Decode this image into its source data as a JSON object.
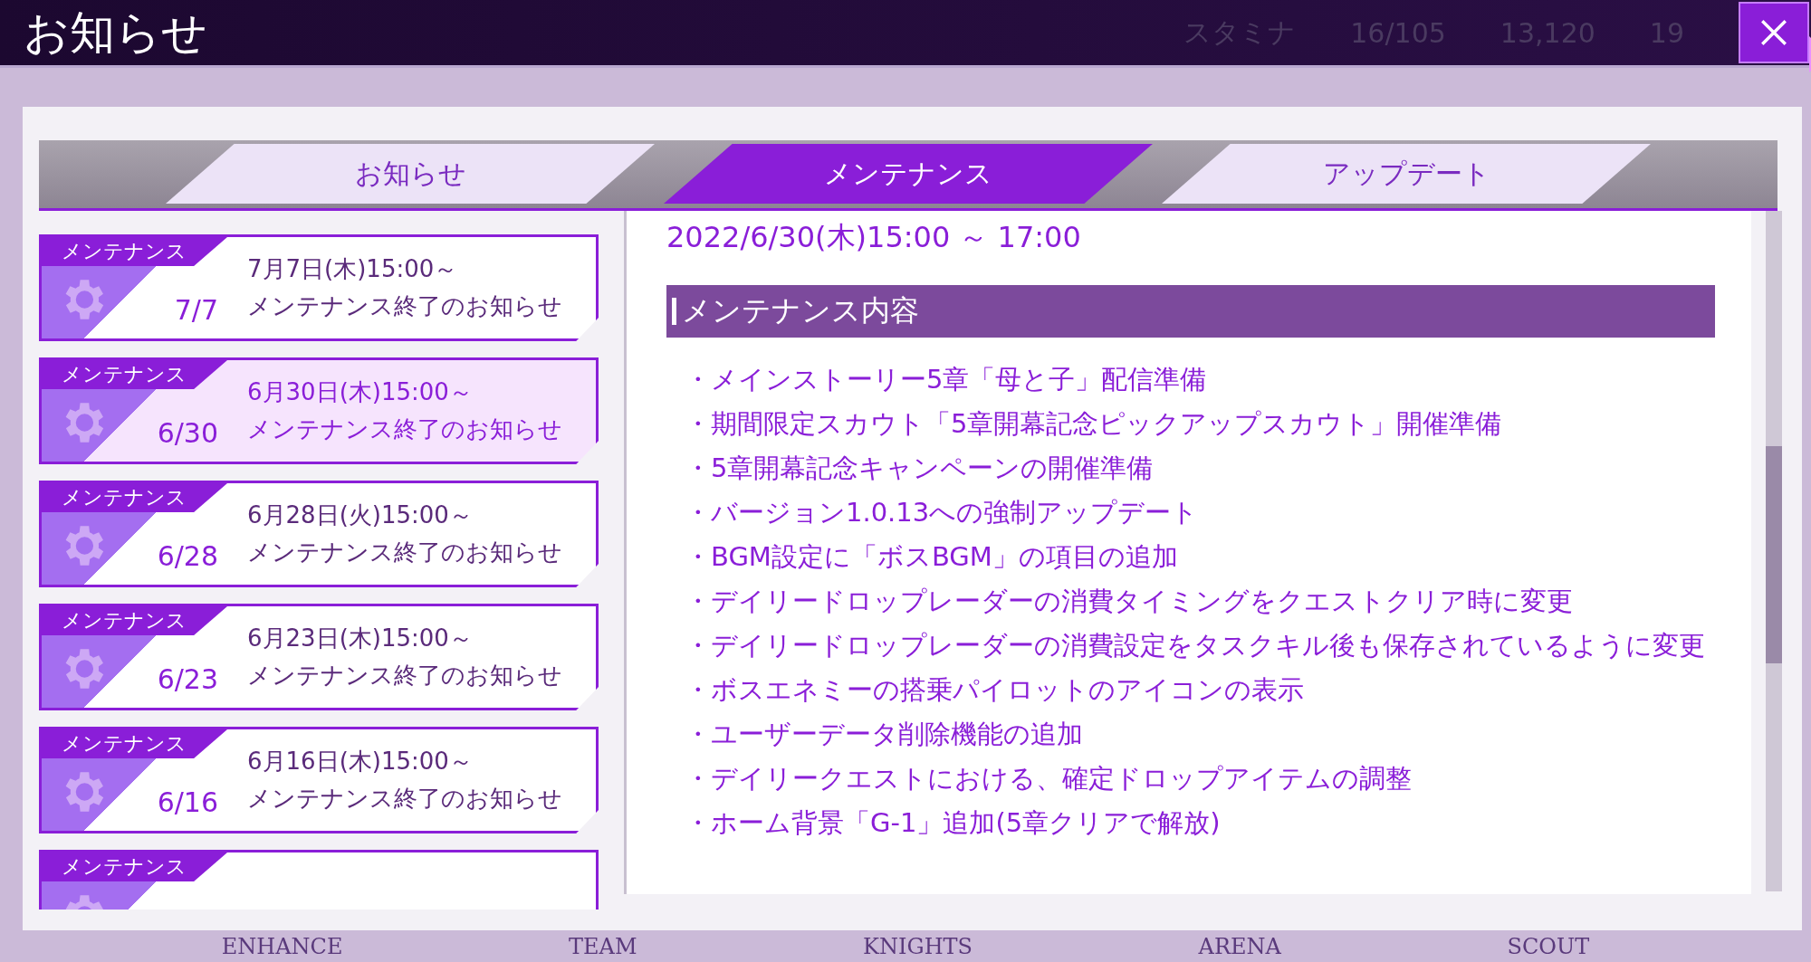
{
  "window": {
    "title": "お知らせ"
  },
  "hud": [
    "スタミナ",
    "16/105",
    "13,120",
    "19"
  ],
  "tabs": [
    {
      "label": "お知らせ",
      "selected": false
    },
    {
      "label": "メンテナンス",
      "selected": true
    },
    {
      "label": "アップデート",
      "selected": false
    }
  ],
  "notices": [
    {
      "tag": "メンテナンス",
      "day": "7/7",
      "date": "7月7日(木)15:00～",
      "title": "メンテナンス終了のお知らせ",
      "selected": false
    },
    {
      "tag": "メンテナンス",
      "day": "6/30",
      "date": "6月30日(木)15:00～",
      "title": "メンテナンス終了のお知らせ",
      "selected": true
    },
    {
      "tag": "メンテナンス",
      "day": "6/28",
      "date": "6月28日(火)15:00～",
      "title": "メンテナンス終了のお知らせ",
      "selected": false
    },
    {
      "tag": "メンテナンス",
      "day": "6/23",
      "date": "6月23日(木)15:00～",
      "title": "メンテナンス終了のお知らせ",
      "selected": false
    },
    {
      "tag": "メンテナンス",
      "day": "6/16",
      "date": "6月16日(木)15:00～",
      "title": "メンテナンス終了のお知らせ",
      "selected": false
    },
    {
      "tag": "メンテナンス",
      "selected": false
    }
  ],
  "article": {
    "schedule": "2022/6/30(木)15:00 ～ 17:00",
    "heading": "メンテナンス内容",
    "items": [
      "・メインストーリー5章「母と子」配信準備",
      "・期間限定スカウト「5章開幕記念ピックアップスカウト」開催準備",
      "・5章開幕記念キャンペーンの開催準備",
      "・バージョン1.0.13への強制アップデート",
      "・BGM設定に「ボスBGM」の項目の追加",
      "・デイリードロップレーダーの消費タイミングをクエストクリア時に変更",
      "・デイリードロップレーダーの消費設定をタスクキル後も保存されているように変更",
      "・ボスエネミーの搭乗パイロットのアイコンの表示",
      "・ユーザーデータ削除機能の追加",
      "・デイリークエストにおける、確定ドロップアイテムの調整",
      "・ホーム背景「G-1」追加(5章クリアで解放)"
    ]
  },
  "bottom_nav": [
    "ENHANCE",
    "TEAM",
    "KNIGHTS",
    "ARENA",
    "SCOUT"
  ]
}
